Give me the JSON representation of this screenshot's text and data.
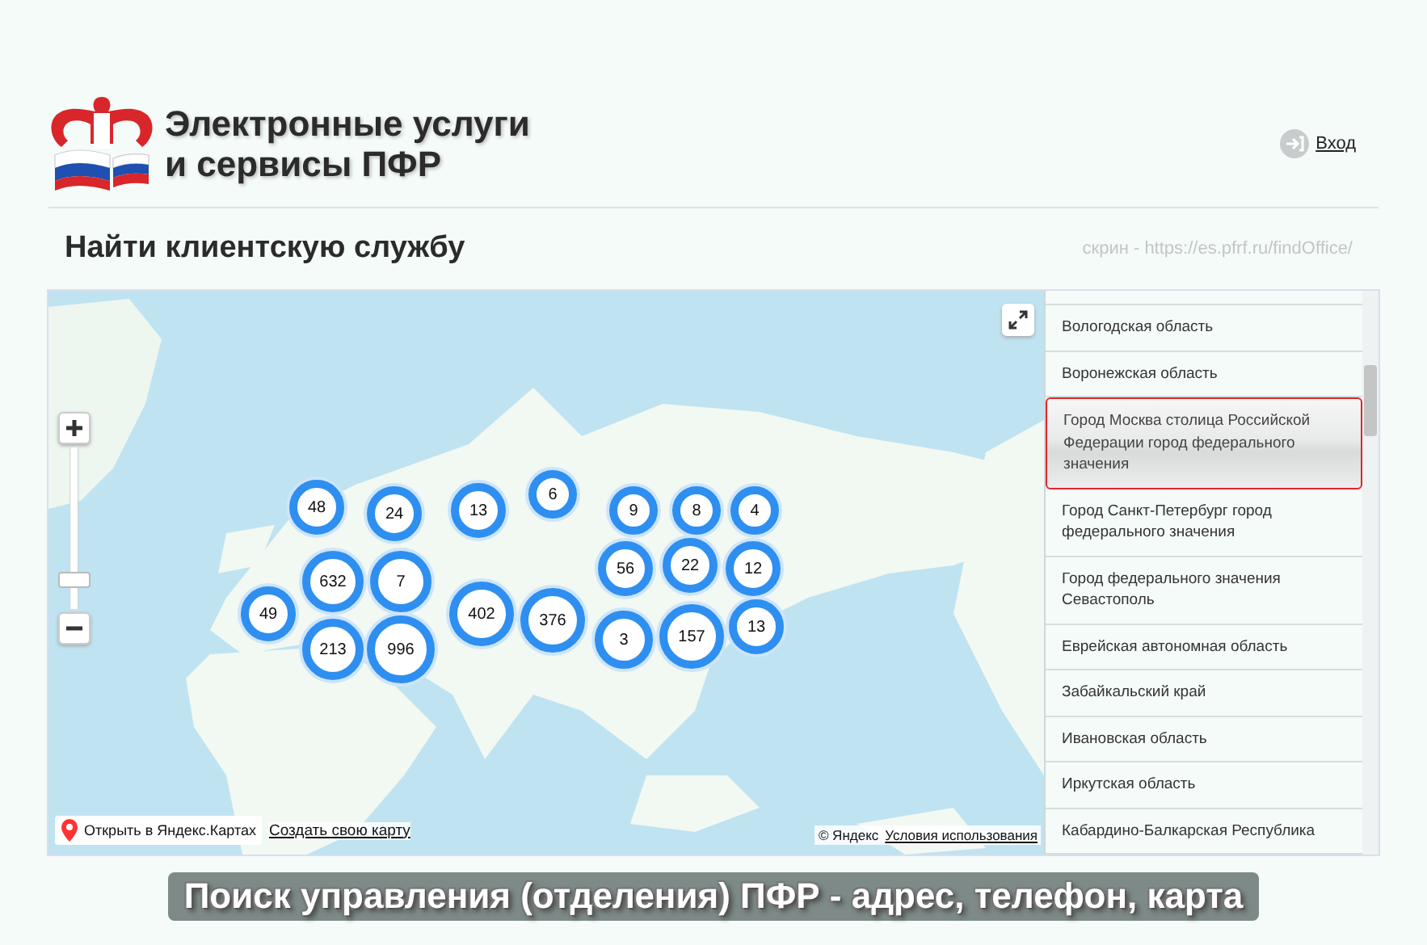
{
  "header": {
    "title_lines": [
      "Электронные услуги",
      "и сервисы ПФР"
    ],
    "login": "Вход"
  },
  "page": {
    "heading": "Найти клиентскую службу",
    "source_note": "скрин - https://es.pfrf.ru/findOffice/"
  },
  "map": {
    "clusters": [
      {
        "count": "48"
      },
      {
        "count": "24"
      },
      {
        "count": "13"
      },
      {
        "count": "6"
      },
      {
        "count": "9"
      },
      {
        "count": "8"
      },
      {
        "count": "4"
      },
      {
        "count": "56"
      },
      {
        "count": "22"
      },
      {
        "count": "12"
      },
      {
        "count": "632"
      },
      {
        "count": "7"
      },
      {
        "count": "49"
      },
      {
        "count": "213"
      },
      {
        "count": "996"
      },
      {
        "count": "402"
      },
      {
        "count": "376"
      },
      {
        "count": "3"
      },
      {
        "count": "157"
      },
      {
        "count": "13"
      }
    ],
    "zoom": {
      "level": 0.15
    },
    "open_link": "Открыть в Яндекс.Картах",
    "create_link": "Создать свою карту",
    "copyright": "© Яндекс",
    "terms_link": "Условия использования"
  },
  "regions": [
    {
      "name": "Вологодская область",
      "selected": false
    },
    {
      "name": "Воронежская область",
      "selected": false
    },
    {
      "name": "Город Москва столица Российской Федерации город федерального значения",
      "selected": true
    },
    {
      "name": "Город Санкт-Петербург город федерального значения",
      "selected": false
    },
    {
      "name": "Город федерального значения Севастополь",
      "selected": false
    },
    {
      "name": "Еврейская автономная область",
      "selected": false
    },
    {
      "name": "Забайкальский край",
      "selected": false
    },
    {
      "name": "Ивановская область",
      "selected": false
    },
    {
      "name": "Иркутская область",
      "selected": false
    },
    {
      "name": "Кабардино-Балкарская Республика",
      "selected": false
    }
  ],
  "caption": "Поиск управления (отделения) ПФР - адрес, телефон, карта"
}
